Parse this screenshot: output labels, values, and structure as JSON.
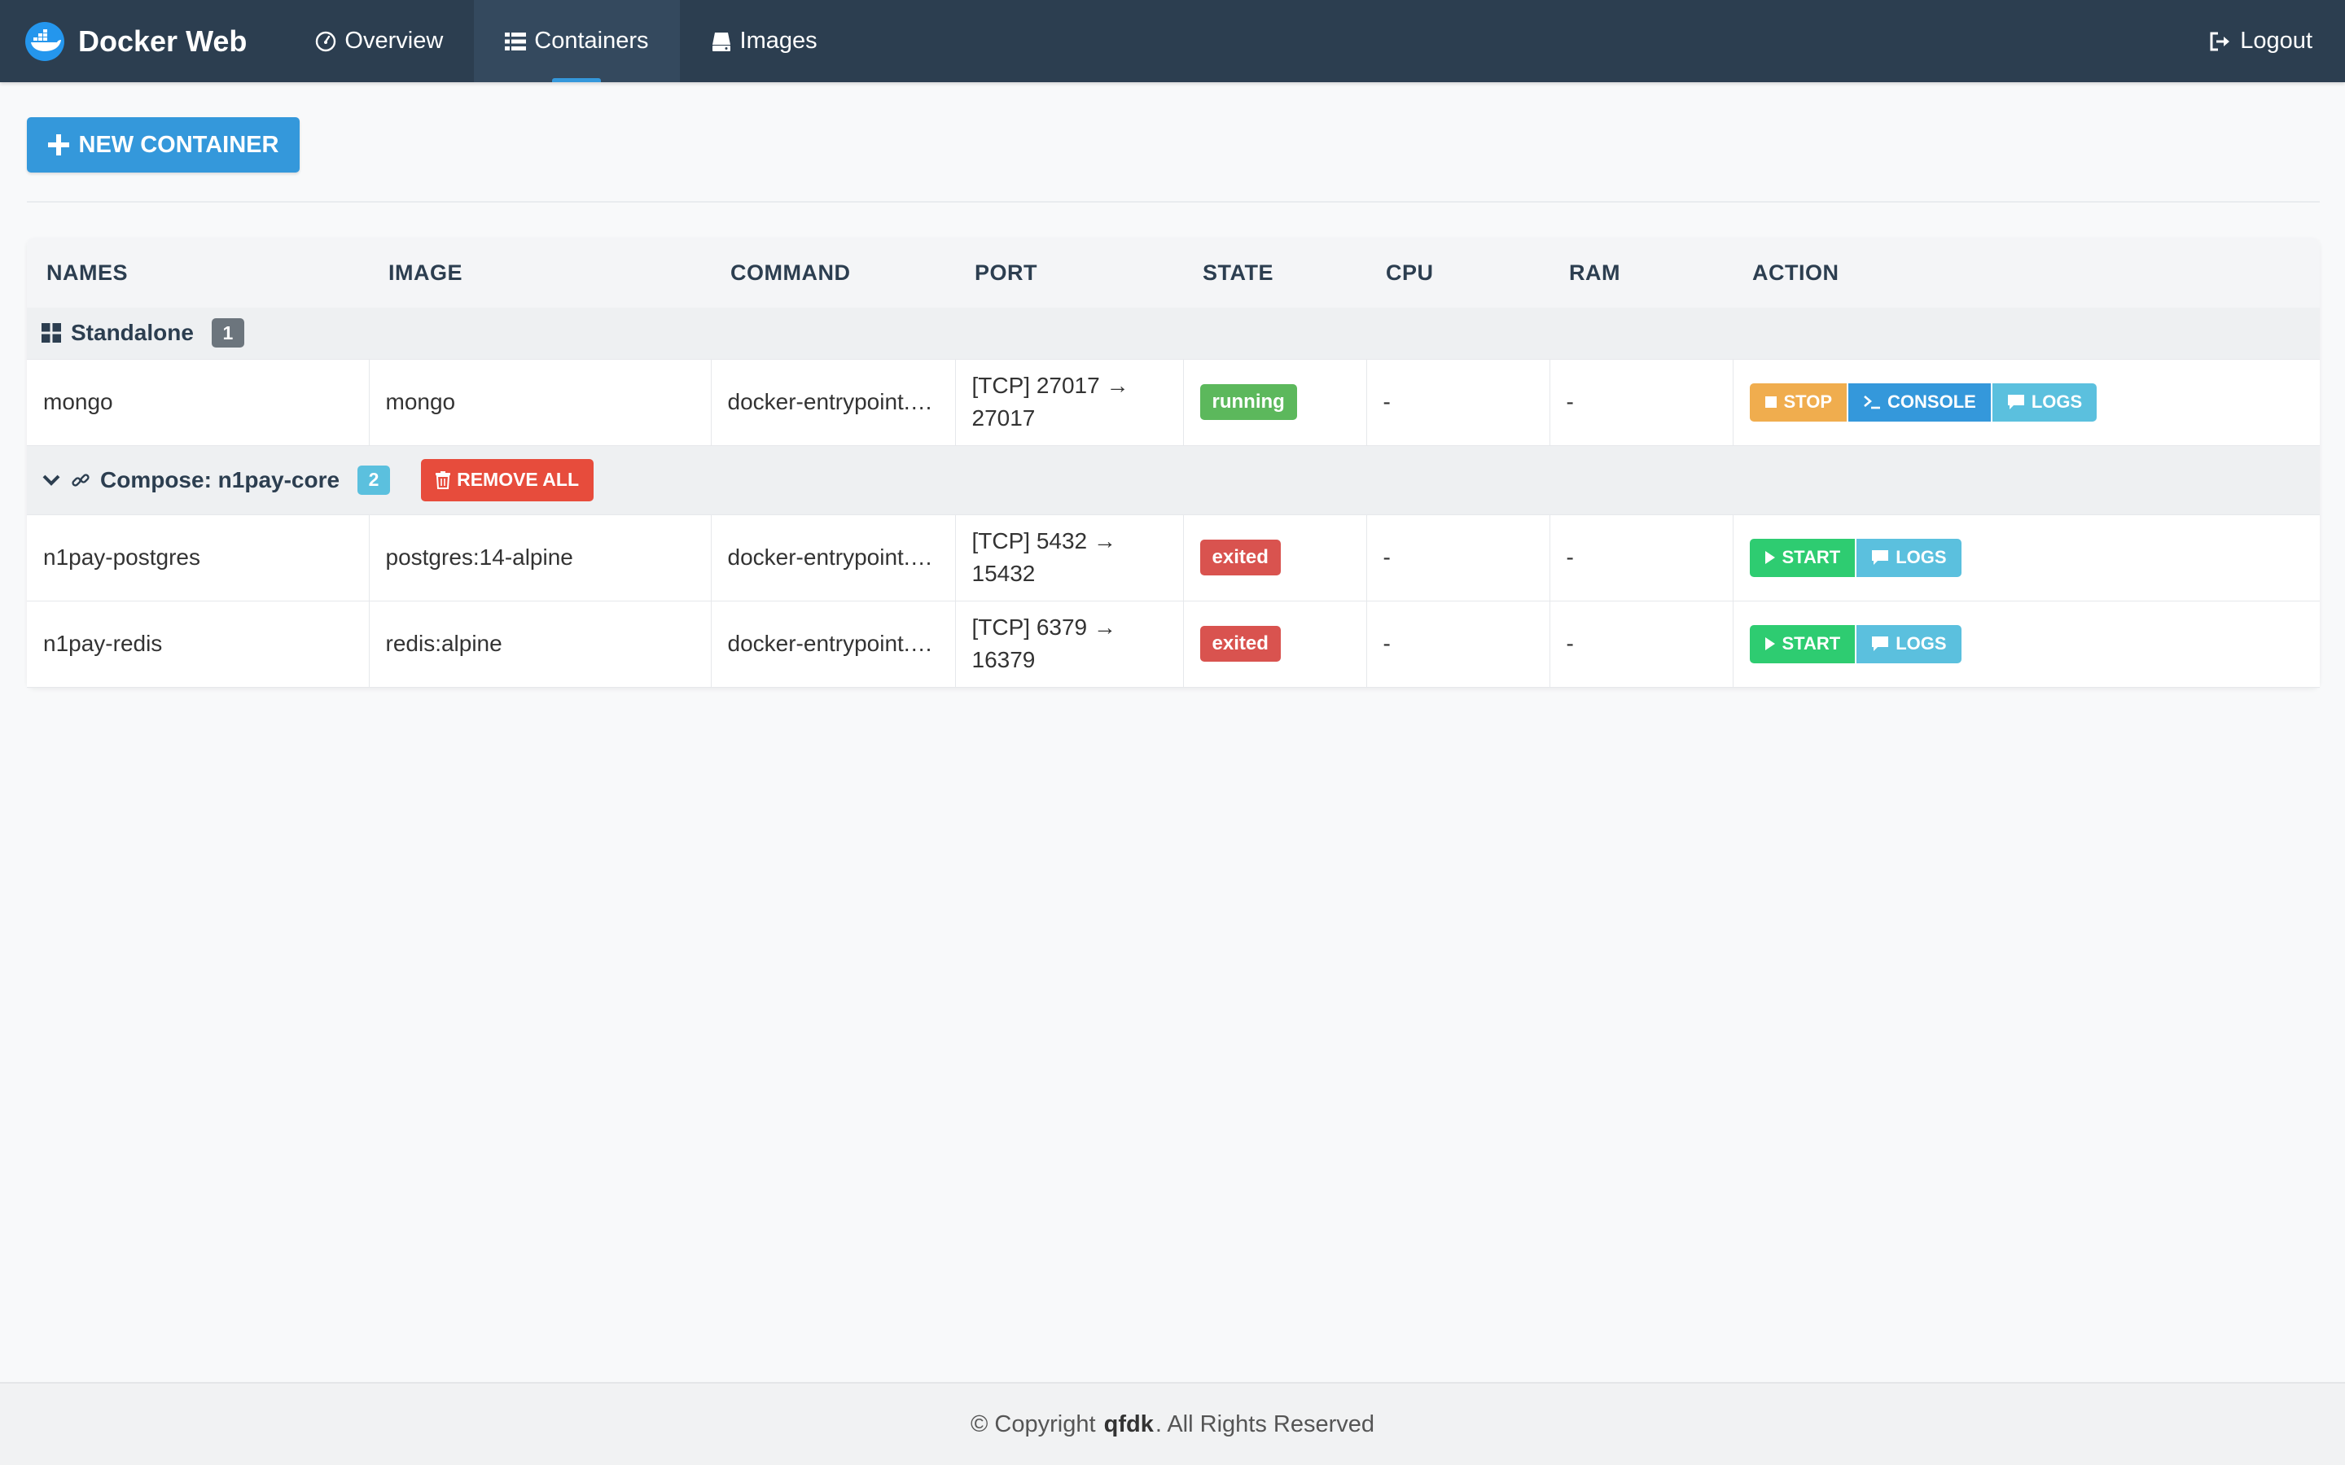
{
  "app": {
    "brand": "Docker Web",
    "nav": [
      {
        "label": "Overview",
        "icon": "dashboard-icon"
      },
      {
        "label": "Containers",
        "icon": "list-icon",
        "active": true
      },
      {
        "label": "Images",
        "icon": "hdd-icon"
      }
    ],
    "logout": "Logout"
  },
  "toolbar": {
    "new_container": "NEW CONTAINER"
  },
  "table": {
    "headers": [
      "NAMES",
      "IMAGE",
      "COMMAND",
      "PORT",
      "STATE",
      "CPU",
      "RAM",
      "ACTION"
    ],
    "groups": {
      "standalone": {
        "label": "Standalone",
        "count": "1"
      },
      "compose": {
        "label": "Compose: n1pay-core",
        "count": "2",
        "remove_all": "REMOVE ALL"
      }
    },
    "rows": [
      {
        "name": "mongo",
        "image": "mongo",
        "command": "docker-entrypoint.…",
        "port_line1": "[TCP] 27017 →",
        "port_line2": "27017",
        "state": "running",
        "cpu": "-",
        "ram": "-"
      },
      {
        "name": "n1pay-postgres",
        "image": "postgres:14-alpine",
        "command": "docker-entrypoint.…",
        "port_line1": "[TCP] 5432 →",
        "port_line2": "15432",
        "state": "exited",
        "cpu": "-",
        "ram": "-"
      },
      {
        "name": "n1pay-redis",
        "image": "redis:alpine",
        "command": "docker-entrypoint.…",
        "port_line1": "[TCP] 6379 →",
        "port_line2": "16379",
        "state": "exited",
        "cpu": "-",
        "ram": "-"
      }
    ],
    "actions": {
      "stop": "STOP",
      "console": "CONSOLE",
      "logs": "LOGS",
      "start": "START"
    }
  },
  "footer": {
    "prefix": "© Copyright",
    "owner": "qfdk",
    "suffix": ". All Rights Reserved"
  },
  "colors": {
    "navbar": "#2c3e50",
    "primary": "#3498db",
    "danger": "#e74c3c",
    "running": "#5cb85c",
    "exited": "#d9534f",
    "warning": "#f0ad4e",
    "info": "#5bc0de",
    "success": "#2ecc71"
  }
}
